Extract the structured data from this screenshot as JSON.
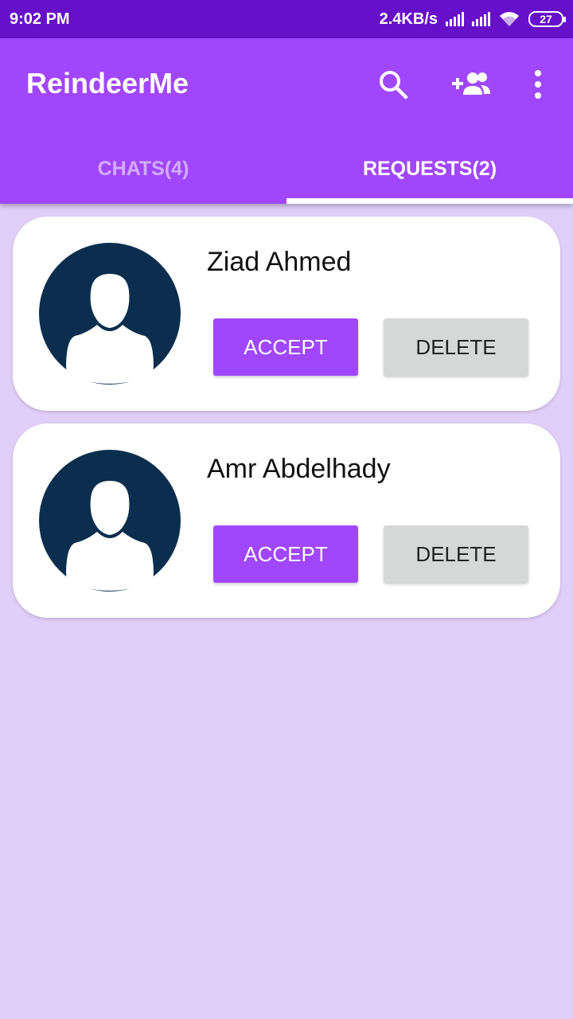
{
  "status_bar": {
    "time": "9:02 PM",
    "network_speed": "2.4KB/s",
    "battery": "27"
  },
  "app_bar": {
    "title": "ReindeerMe",
    "icons": [
      "search-icon",
      "add-friend-icon",
      "more-vert-icon"
    ]
  },
  "tabs": [
    {
      "label": "CHATS(4)",
      "active": false
    },
    {
      "label": "REQUESTS(2)",
      "active": true
    }
  ],
  "requests": [
    {
      "name": "Ziad Ahmed",
      "accept_label": "ACCEPT",
      "delete_label": "DELETE"
    },
    {
      "name": "Amr Abdelhady",
      "accept_label": "ACCEPT",
      "delete_label": "DELETE"
    }
  ],
  "colors": {
    "status_bar": "#6610c9",
    "app_bar": "#a047fd",
    "background": "#e2cff9",
    "accept": "#a047fd",
    "delete": "#d6d7d7",
    "avatar": "#0c2e4e"
  }
}
